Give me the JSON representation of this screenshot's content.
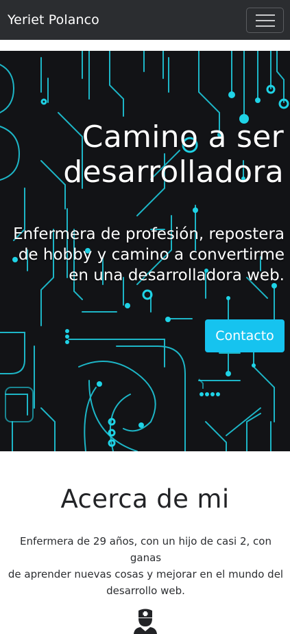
{
  "navbar": {
    "brand": "Yeriet Polanco",
    "toggle_icon": "hamburger-icon"
  },
  "hero": {
    "title_line1": "Camino a ser",
    "title_line2": "desarrolladora",
    "subtitle_line1": "Enfermera de profesión, repostera",
    "subtitle_line2": "de hobby y camino a convertirme",
    "subtitle_line3": "en una desarrolladora web.",
    "cta_label": "Contacto",
    "background_icon": "circuit-board-pattern"
  },
  "about": {
    "title": "Acerca de mi",
    "text_line1": "Enfermera de 29 años, con un hijo de casi 2, con ganas",
    "text_line2": "de aprender nuevas cosas y mejorar en el mundo del",
    "text_line3": "desarrollo web.",
    "icon": "nurse-icon"
  },
  "colors": {
    "navbar_bg": "#2b2d30",
    "hero_bg": "#121316",
    "accent": "#16c3ef",
    "circuit": "#1fd3e6"
  }
}
